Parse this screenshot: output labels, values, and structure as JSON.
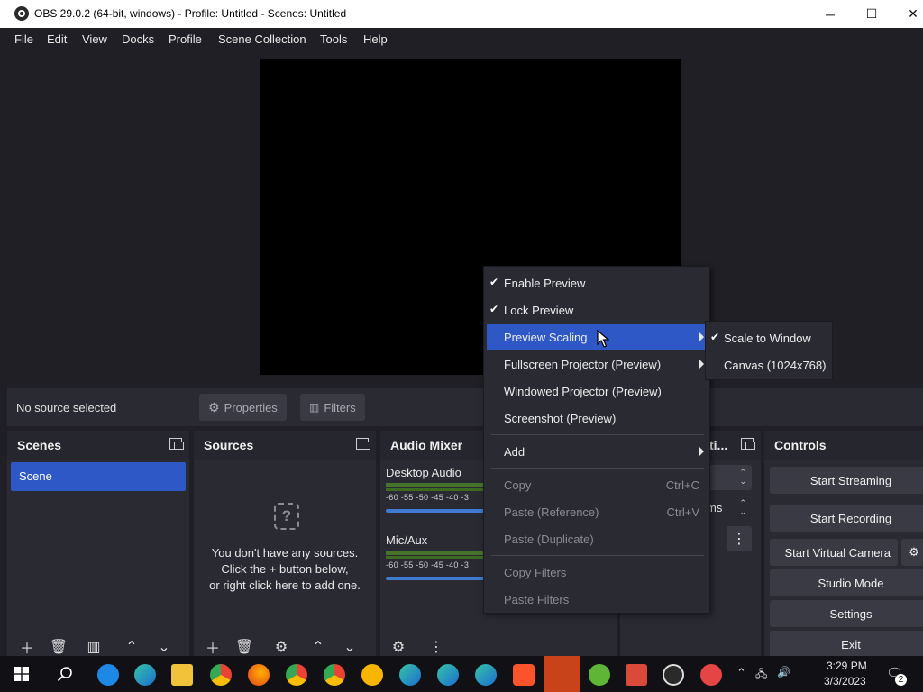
{
  "window": {
    "title": "OBS 29.0.2 (64-bit, windows) - Profile: Untitled - Scenes: Untitled",
    "minimize": "─",
    "maximize": "☐",
    "close": "✕"
  },
  "menubar": {
    "items": [
      "File",
      "Edit",
      "View",
      "Docks",
      "Profile",
      "Scene Collection",
      "Tools",
      "Help"
    ]
  },
  "contextbar": {
    "status": "No source selected",
    "properties": "Properties",
    "filters": "Filters"
  },
  "docks": {
    "scenes": {
      "title": "Scenes",
      "items": [
        "Scene"
      ]
    },
    "sources": {
      "title": "Sources",
      "empty_lines": [
        "You don't have any sources.",
        "Click the + button below,",
        "or right click here to add one."
      ]
    },
    "mixer": {
      "title": "Audio Mixer",
      "channels": [
        {
          "name": "Desktop Audio",
          "scale": "-60 -55 -50 -45 -40 -3"
        },
        {
          "name": "Mic/Aux",
          "scale": "-60 -55 -50 -45 -40 -3"
        }
      ]
    },
    "transitions": {
      "title_fragment": "ti...",
      "field_fragment": "ms"
    },
    "controls": {
      "title": "Controls",
      "buttons": [
        "Start Streaming",
        "Start Recording",
        "Start Virtual Camera",
        "Studio Mode",
        "Settings",
        "Exit"
      ]
    }
  },
  "context_menu": {
    "items": [
      {
        "label": "Enable Preview",
        "checked": true
      },
      {
        "label": "Lock Preview",
        "checked": true
      },
      {
        "label": "Preview Scaling",
        "submenu": true,
        "highlighted": true
      },
      {
        "label": "Fullscreen Projector (Preview)",
        "submenu": true
      },
      {
        "label": "Windowed Projector (Preview)"
      },
      {
        "label": "Screenshot (Preview)"
      },
      {
        "label": "Add",
        "submenu": true
      },
      {
        "label": "Copy",
        "shortcut": "Ctrl+C",
        "disabled": true
      },
      {
        "label": "Paste (Reference)",
        "shortcut": "Ctrl+V",
        "disabled": true
      },
      {
        "label": "Paste (Duplicate)",
        "disabled": true
      },
      {
        "label": "Copy Filters",
        "disabled": true
      },
      {
        "label": "Paste Filters",
        "disabled": true
      }
    ],
    "submenu": [
      {
        "label": "Scale to Window",
        "checked": true
      },
      {
        "label": "Canvas (1024x768)"
      }
    ]
  },
  "taskbar": {
    "time": "3:29 PM",
    "date": "3/3/2023",
    "notifications": "2"
  },
  "colors": {
    "accent": "#2e58c5",
    "background": "#1f1f25",
    "panel": "#2a2a33"
  }
}
